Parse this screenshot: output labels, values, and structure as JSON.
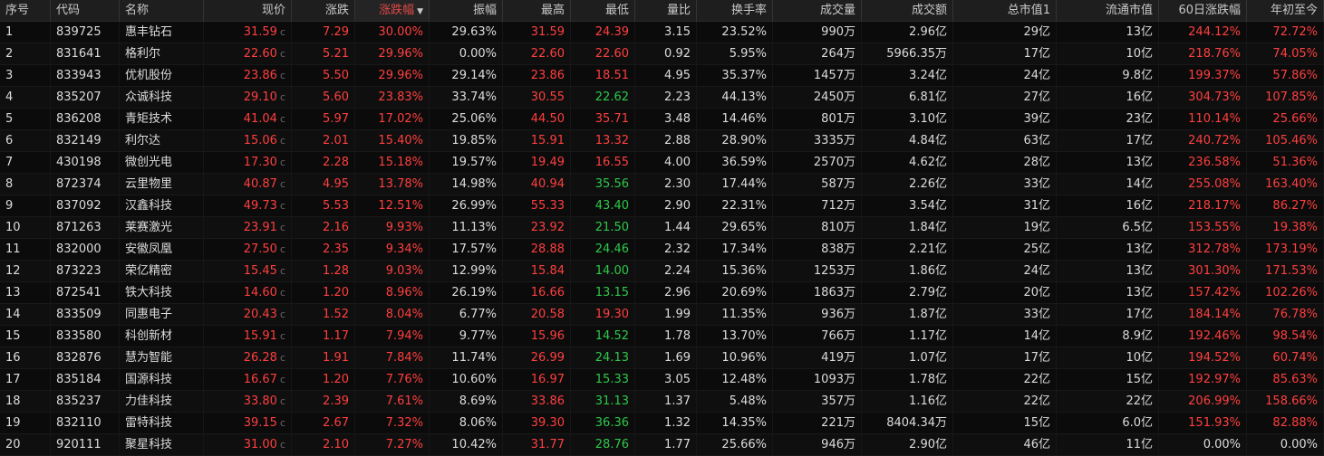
{
  "columns": [
    {
      "key": "idx",
      "label": "序号",
      "align": "l",
      "cls": "w-idx"
    },
    {
      "key": "code",
      "label": "代码",
      "align": "l",
      "cls": "w-code"
    },
    {
      "key": "name",
      "label": "名称",
      "align": "l",
      "cls": "w-name"
    },
    {
      "key": "price",
      "label": "现价",
      "align": "r",
      "cls": "w-price"
    },
    {
      "key": "chg",
      "label": "涨跌",
      "align": "r",
      "cls": "w-chg"
    },
    {
      "key": "pct",
      "label": "涨跌幅",
      "align": "r",
      "cls": "w-pct",
      "sorted": true
    },
    {
      "key": "amp",
      "label": "振幅",
      "align": "r",
      "cls": "w-amp"
    },
    {
      "key": "high",
      "label": "最高",
      "align": "r",
      "cls": "w-high"
    },
    {
      "key": "low",
      "label": "最低",
      "align": "r",
      "cls": "w-low"
    },
    {
      "key": "vr",
      "label": "量比",
      "align": "r",
      "cls": "w-vr"
    },
    {
      "key": "turn",
      "label": "换手率",
      "align": "r",
      "cls": "w-turn"
    },
    {
      "key": "vol",
      "label": "成交量",
      "align": "r",
      "cls": "w-vol"
    },
    {
      "key": "amt",
      "label": "成交额",
      "align": "r",
      "cls": "w-amt"
    },
    {
      "key": "mcap",
      "label": "总市值1",
      "align": "r",
      "cls": "w-mcap"
    },
    {
      "key": "fcap",
      "label": "流通市值",
      "align": "r",
      "cls": "w-fcap"
    },
    {
      "key": "c60",
      "label": "60日涨跌幅",
      "align": "r",
      "cls": "w-c60"
    },
    {
      "key": "ytd",
      "label": "年初至今",
      "align": "r",
      "cls": "w-ytd"
    }
  ],
  "sort_indicator": "▼",
  "price_suffix": "c",
  "colors": {
    "up": "#ff3f3f",
    "down": "#2ec84a",
    "neutral": "#dcdcdc"
  },
  "rows": [
    {
      "idx": "1",
      "code": "839725",
      "name": "惠丰钻石",
      "price": "31.59",
      "chg": "7.29",
      "pct": "30.00%",
      "amp": "29.63%",
      "high": "31.59",
      "low": "24.39",
      "low_dir": "up",
      "vr": "3.15",
      "turn": "23.52%",
      "vol": "990万",
      "amt": "2.96亿",
      "mcap": "29亿",
      "fcap": "13亿",
      "c60": "244.12%",
      "c60_dir": "up",
      "ytd": "72.72%",
      "ytd_dir": "up"
    },
    {
      "idx": "2",
      "code": "831641",
      "name": "格利尔",
      "price": "22.60",
      "chg": "5.21",
      "pct": "29.96%",
      "amp": "0.00%",
      "high": "22.60",
      "low": "22.60",
      "low_dir": "up",
      "vr": "0.92",
      "turn": "5.95%",
      "vol": "264万",
      "amt": "5966.35万",
      "mcap": "17亿",
      "fcap": "10亿",
      "c60": "218.76%",
      "c60_dir": "up",
      "ytd": "74.05%",
      "ytd_dir": "up"
    },
    {
      "idx": "3",
      "code": "833943",
      "name": "优机股份",
      "price": "23.86",
      "chg": "5.50",
      "pct": "29.96%",
      "amp": "29.14%",
      "high": "23.86",
      "low": "18.51",
      "low_dir": "up",
      "vr": "4.95",
      "turn": "35.37%",
      "vol": "1457万",
      "amt": "3.24亿",
      "mcap": "24亿",
      "fcap": "9.8亿",
      "c60": "199.37%",
      "c60_dir": "up",
      "ytd": "57.86%",
      "ytd_dir": "up"
    },
    {
      "idx": "4",
      "code": "835207",
      "name": "众诚科技",
      "price": "29.10",
      "chg": "5.60",
      "pct": "23.83%",
      "amp": "33.74%",
      "high": "30.55",
      "low": "22.62",
      "low_dir": "down",
      "vr": "2.23",
      "turn": "44.13%",
      "vol": "2450万",
      "amt": "6.81亿",
      "mcap": "27亿",
      "fcap": "16亿",
      "c60": "304.73%",
      "c60_dir": "up",
      "ytd": "107.85%",
      "ytd_dir": "up"
    },
    {
      "idx": "5",
      "code": "836208",
      "name": "青矩技术",
      "price": "41.04",
      "chg": "5.97",
      "pct": "17.02%",
      "amp": "25.06%",
      "high": "44.50",
      "low": "35.71",
      "low_dir": "up",
      "vr": "3.48",
      "turn": "14.46%",
      "vol": "801万",
      "amt": "3.10亿",
      "mcap": "39亿",
      "fcap": "23亿",
      "c60": "110.14%",
      "c60_dir": "up",
      "ytd": "25.66%",
      "ytd_dir": "up"
    },
    {
      "idx": "6",
      "code": "832149",
      "name": "利尔达",
      "price": "15.06",
      "chg": "2.01",
      "pct": "15.40%",
      "amp": "19.85%",
      "high": "15.91",
      "low": "13.32",
      "low_dir": "up",
      "vr": "2.88",
      "turn": "28.90%",
      "vol": "3335万",
      "amt": "4.84亿",
      "mcap": "63亿",
      "fcap": "17亿",
      "c60": "240.72%",
      "c60_dir": "up",
      "ytd": "105.46%",
      "ytd_dir": "up"
    },
    {
      "idx": "7",
      "code": "430198",
      "name": "微创光电",
      "price": "17.30",
      "chg": "2.28",
      "pct": "15.18%",
      "amp": "19.57%",
      "high": "19.49",
      "low": "16.55",
      "low_dir": "up",
      "vr": "4.00",
      "turn": "36.59%",
      "vol": "2570万",
      "amt": "4.62亿",
      "mcap": "28亿",
      "fcap": "13亿",
      "c60": "236.58%",
      "c60_dir": "up",
      "ytd": "51.36%",
      "ytd_dir": "up"
    },
    {
      "idx": "8",
      "code": "872374",
      "name": "云里物里",
      "price": "40.87",
      "chg": "4.95",
      "pct": "13.78%",
      "amp": "14.98%",
      "high": "40.94",
      "low": "35.56",
      "low_dir": "down",
      "vr": "2.30",
      "turn": "17.44%",
      "vol": "587万",
      "amt": "2.26亿",
      "mcap": "33亿",
      "fcap": "14亿",
      "c60": "255.08%",
      "c60_dir": "up",
      "ytd": "163.40%",
      "ytd_dir": "up"
    },
    {
      "idx": "9",
      "code": "837092",
      "name": "汉鑫科技",
      "price": "49.73",
      "chg": "5.53",
      "pct": "12.51%",
      "amp": "26.99%",
      "high": "55.33",
      "low": "43.40",
      "low_dir": "down",
      "vr": "2.90",
      "turn": "22.31%",
      "vol": "712万",
      "amt": "3.54亿",
      "mcap": "31亿",
      "fcap": "16亿",
      "c60": "218.17%",
      "c60_dir": "up",
      "ytd": "86.27%",
      "ytd_dir": "up"
    },
    {
      "idx": "10",
      "code": "871263",
      "name": "莱赛激光",
      "price": "23.91",
      "chg": "2.16",
      "pct": "9.93%",
      "amp": "11.13%",
      "high": "23.92",
      "low": "21.50",
      "low_dir": "down",
      "vr": "1.44",
      "turn": "29.65%",
      "vol": "810万",
      "amt": "1.84亿",
      "mcap": "19亿",
      "fcap": "6.5亿",
      "c60": "153.55%",
      "c60_dir": "up",
      "ytd": "19.38%",
      "ytd_dir": "up"
    },
    {
      "idx": "11",
      "code": "832000",
      "name": "安徽凤凰",
      "price": "27.50",
      "chg": "2.35",
      "pct": "9.34%",
      "amp": "17.57%",
      "high": "28.88",
      "low": "24.46",
      "low_dir": "down",
      "vr": "2.32",
      "turn": "17.34%",
      "vol": "838万",
      "amt": "2.21亿",
      "mcap": "25亿",
      "fcap": "13亿",
      "c60": "312.78%",
      "c60_dir": "up",
      "ytd": "173.19%",
      "ytd_dir": "up"
    },
    {
      "idx": "12",
      "code": "873223",
      "name": "荣亿精密",
      "price": "15.45",
      "chg": "1.28",
      "pct": "9.03%",
      "amp": "12.99%",
      "high": "15.84",
      "low": "14.00",
      "low_dir": "down",
      "vr": "2.24",
      "turn": "15.36%",
      "vol": "1253万",
      "amt": "1.86亿",
      "mcap": "24亿",
      "fcap": "13亿",
      "c60": "301.30%",
      "c60_dir": "up",
      "ytd": "171.53%",
      "ytd_dir": "up"
    },
    {
      "idx": "13",
      "code": "872541",
      "name": "铁大科技",
      "price": "14.60",
      "chg": "1.20",
      "pct": "8.96%",
      "amp": "26.19%",
      "high": "16.66",
      "low": "13.15",
      "low_dir": "down",
      "vr": "2.96",
      "turn": "20.69%",
      "vol": "1863万",
      "amt": "2.79亿",
      "mcap": "20亿",
      "fcap": "13亿",
      "c60": "157.42%",
      "c60_dir": "up",
      "ytd": "102.26%",
      "ytd_dir": "up"
    },
    {
      "idx": "14",
      "code": "833509",
      "name": "同惠电子",
      "price": "20.43",
      "chg": "1.52",
      "pct": "8.04%",
      "amp": "6.77%",
      "high": "20.58",
      "low": "19.30",
      "low_dir": "up",
      "vr": "1.99",
      "turn": "11.35%",
      "vol": "936万",
      "amt": "1.87亿",
      "mcap": "33亿",
      "fcap": "17亿",
      "c60": "184.14%",
      "c60_dir": "up",
      "ytd": "76.78%",
      "ytd_dir": "up"
    },
    {
      "idx": "15",
      "code": "833580",
      "name": "科创新材",
      "price": "15.91",
      "chg": "1.17",
      "pct": "7.94%",
      "amp": "9.77%",
      "high": "15.96",
      "low": "14.52",
      "low_dir": "down",
      "vr": "1.78",
      "turn": "13.70%",
      "vol": "766万",
      "amt": "1.17亿",
      "mcap": "14亿",
      "fcap": "8.9亿",
      "c60": "192.46%",
      "c60_dir": "up",
      "ytd": "98.54%",
      "ytd_dir": "up"
    },
    {
      "idx": "16",
      "code": "832876",
      "name": "慧为智能",
      "price": "26.28",
      "chg": "1.91",
      "pct": "7.84%",
      "amp": "11.74%",
      "high": "26.99",
      "low": "24.13",
      "low_dir": "down",
      "vr": "1.69",
      "turn": "10.96%",
      "vol": "419万",
      "amt": "1.07亿",
      "mcap": "17亿",
      "fcap": "10亿",
      "c60": "194.52%",
      "c60_dir": "up",
      "ytd": "60.74%",
      "ytd_dir": "up"
    },
    {
      "idx": "17",
      "code": "835184",
      "name": "国源科技",
      "price": "16.67",
      "chg": "1.20",
      "pct": "7.76%",
      "amp": "10.60%",
      "high": "16.97",
      "low": "15.33",
      "low_dir": "down",
      "vr": "3.05",
      "turn": "12.48%",
      "vol": "1093万",
      "amt": "1.78亿",
      "mcap": "22亿",
      "fcap": "15亿",
      "c60": "192.97%",
      "c60_dir": "up",
      "ytd": "85.63%",
      "ytd_dir": "up"
    },
    {
      "idx": "18",
      "code": "835237",
      "name": "力佳科技",
      "price": "33.80",
      "chg": "2.39",
      "pct": "7.61%",
      "amp": "8.69%",
      "high": "33.86",
      "low": "31.13",
      "low_dir": "down",
      "vr": "1.37",
      "turn": "5.48%",
      "vol": "357万",
      "amt": "1.16亿",
      "mcap": "22亿",
      "fcap": "22亿",
      "c60": "206.99%",
      "c60_dir": "up",
      "ytd": "158.66%",
      "ytd_dir": "up"
    },
    {
      "idx": "19",
      "code": "832110",
      "name": "雷特科技",
      "price": "39.15",
      "chg": "2.67",
      "pct": "7.32%",
      "amp": "8.06%",
      "high": "39.30",
      "low": "36.36",
      "low_dir": "down",
      "vr": "1.32",
      "turn": "14.35%",
      "vol": "221万",
      "amt": "8404.34万",
      "mcap": "15亿",
      "fcap": "6.0亿",
      "c60": "151.93%",
      "c60_dir": "up",
      "ytd": "82.88%",
      "ytd_dir": "up"
    },
    {
      "idx": "20",
      "code": "920111",
      "name": "聚星科技",
      "price": "31.00",
      "chg": "2.10",
      "pct": "7.27%",
      "amp": "10.42%",
      "high": "31.77",
      "low": "28.76",
      "low_dir": "down",
      "vr": "1.77",
      "turn": "25.66%",
      "vol": "946万",
      "amt": "2.90亿",
      "mcap": "46亿",
      "fcap": "11亿",
      "c60": "0.00%",
      "c60_dir": "neutral",
      "ytd": "0.00%",
      "ytd_dir": "neutral"
    }
  ]
}
